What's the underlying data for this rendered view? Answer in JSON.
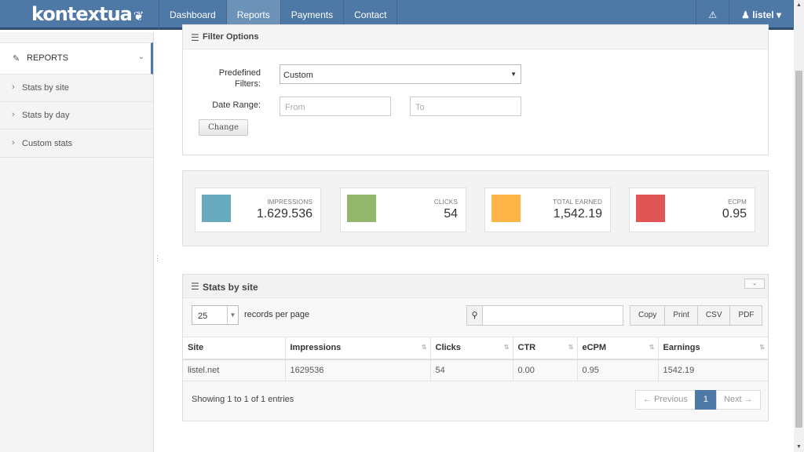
{
  "app": {
    "brand": "kontextua"
  },
  "nav": {
    "items": [
      {
        "label": "Dashboard",
        "active": false
      },
      {
        "label": "Reports",
        "active": true
      },
      {
        "label": "Payments",
        "active": false
      },
      {
        "label": "Contact",
        "active": false
      }
    ],
    "alert_icon": "warning-icon",
    "user_label": "listel"
  },
  "sidebar": {
    "section_title": "REPORTS",
    "items": [
      {
        "label": "Stats by site"
      },
      {
        "label": "Stats by day"
      },
      {
        "label": "Custom stats"
      }
    ]
  },
  "filter": {
    "title": "Filter Options",
    "predefined_label": "Predefined Filters:",
    "predefined_value": "Custom",
    "date_range_label": "Date Range:",
    "from_placeholder": "From",
    "to_placeholder": "To",
    "change_button": "Change"
  },
  "stats": [
    {
      "label": "IMPRESSIONS",
      "value": "1.629.536",
      "color": "#67a9bd"
    },
    {
      "label": "CLICKS",
      "value": "54",
      "color": "#92b76c"
    },
    {
      "label": "TOTAL EARNED",
      "value": "1,542.19",
      "color": "#fdb547"
    },
    {
      "label": "ECPM",
      "value": "0.95",
      "color": "#e05555"
    }
  ],
  "table": {
    "title": "Stats by site",
    "page_length": "25",
    "records_label": "records per page",
    "export_buttons": [
      "Copy",
      "Print",
      "CSV",
      "PDF"
    ],
    "columns": [
      "Site",
      "Impressions",
      "Clicks",
      "CTR",
      "eCPM",
      "Earnings"
    ],
    "rows": [
      [
        "listel.net",
        "1629536",
        "54",
        "0.00",
        "0.95",
        "1542.19"
      ]
    ],
    "info": "Showing 1 to 1 of 1 entries",
    "pagination": {
      "previous": "← Previous",
      "current": "1",
      "next": "Next →"
    }
  },
  "colors": {
    "navbar": "#4e78a6",
    "nav_active": "#6d92b8",
    "accent": "#4e78a6"
  }
}
